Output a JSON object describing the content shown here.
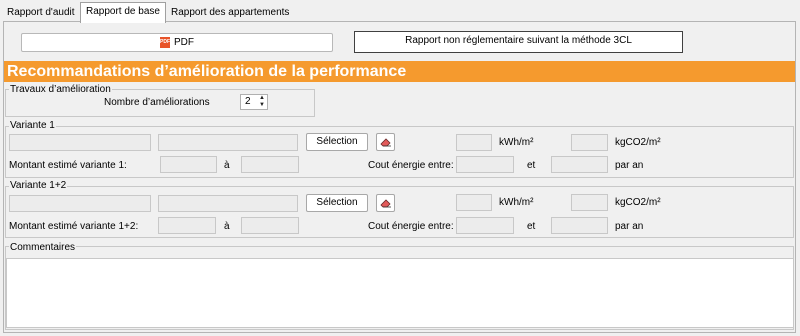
{
  "tabs": [
    {
      "label": "Rapport d'audit",
      "active": false
    },
    {
      "label": "Rapport de base",
      "active": true
    },
    {
      "label": "Rapport des appartements",
      "active": false
    }
  ],
  "pdf_button": {
    "label": "PDF",
    "icon": "pdf-icon"
  },
  "notice": "Rapport non réglementaire suivant la méthode 3CL",
  "banner": {
    "title": "Recommandations d’amélioration de la performance",
    "color": "#f59a2e"
  },
  "travaux": {
    "group_label": "Travaux d’amélioration",
    "count_label": "Nombre d’améliorations",
    "count_value": "2"
  },
  "variante1": {
    "label": "Variante 1",
    "selection_label": "Sélection",
    "kwh_unit": "kWh/m²",
    "co2_unit": "kgCO2/m²",
    "montant_label": "Montant estimé variante 1:",
    "a_label": "à",
    "cout_label": "Cout énergie entre:",
    "et_label": "et",
    "par_an_label": "par an"
  },
  "variante12": {
    "label": "Variante 1+2",
    "selection_label": "Sélection",
    "kwh_unit": "kWh/m²",
    "co2_unit": "kgCO2/m²",
    "montant_label": "Montant estimé variante 1+2:",
    "a_label": "à",
    "cout_label": "Cout énergie entre:",
    "et_label": "et",
    "par_an_label": "par an"
  },
  "commentaires_label": "Commentaires"
}
